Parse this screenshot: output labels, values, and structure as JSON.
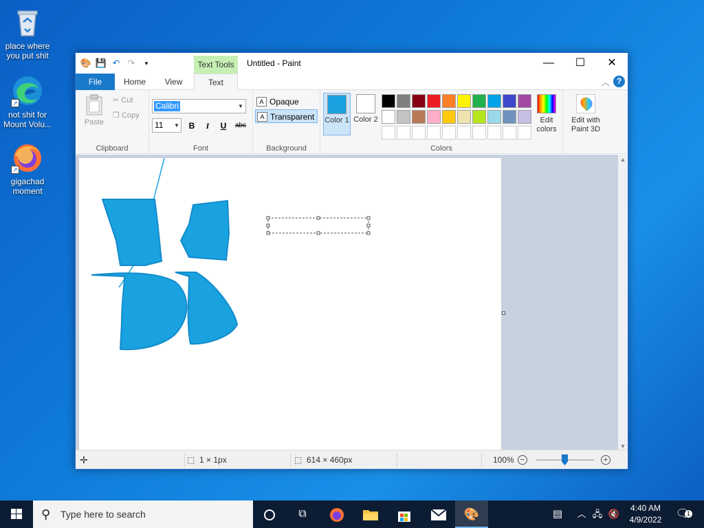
{
  "desktop": {
    "icons": [
      {
        "label": "place where you put shit"
      },
      {
        "label": "not shit for Mount Volu..."
      },
      {
        "label": "gigachad moment"
      }
    ]
  },
  "window": {
    "title": "Untitled - Paint",
    "context_tab": "Text Tools",
    "tabs": {
      "file": "File",
      "home": "Home",
      "view": "View",
      "text": "Text"
    },
    "clipboard": {
      "paste": "Paste",
      "cut": "Cut",
      "copy": "Copy",
      "group_label": "Clipboard"
    },
    "font": {
      "family": "Calibri",
      "size": "11",
      "bold": "B",
      "italic": "I",
      "underline": "U",
      "strike": "abc",
      "group_label": "Font"
    },
    "background": {
      "opaque": "Opaque",
      "transparent": "Transparent",
      "group_label": "Background"
    },
    "colors": {
      "color1_label": "Color 1",
      "color2_label": "Color 2",
      "color1_value": "#1aa1e0",
      "color2_value": "#ffffff",
      "edit_colors": "Edit colors",
      "paint3d": "Edit with Paint 3D",
      "group_label": "Colors",
      "palette": [
        "#000000",
        "#7f7f7f",
        "#880015",
        "#ed1c24",
        "#ff7f27",
        "#fff200",
        "#22b14c",
        "#00a2e8",
        "#3f48cc",
        "#a349a4",
        "#ffffff",
        "#c3c3c3",
        "#b97a57",
        "#ffaec9",
        "#ffc90e",
        "#efe4b0",
        "#b5e61d",
        "#99d9ea",
        "#7092be",
        "#c8bfe7",
        "#ffffff",
        "#ffffff",
        "#ffffff",
        "#ffffff",
        "#ffffff",
        "#ffffff",
        "#ffffff",
        "#ffffff",
        "#ffffff",
        "#ffffff"
      ]
    },
    "status": {
      "selection_size": "1 × 1px",
      "image_size": "614 × 460px",
      "zoom": "100%"
    }
  },
  "taskbar": {
    "search_placeholder": "Type here to search",
    "time": "4:40 AM",
    "date": "4/9/2022",
    "notification_count": "1"
  }
}
